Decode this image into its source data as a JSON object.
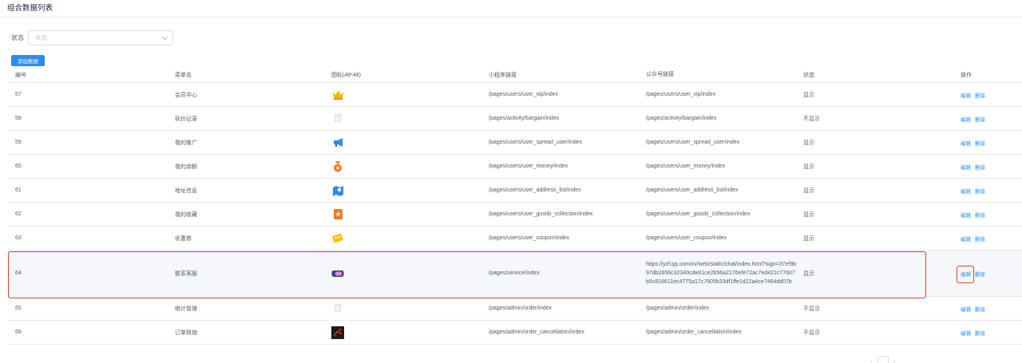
{
  "page": {
    "title": "组合数据列表"
  },
  "filter": {
    "label": "状态",
    "placeholder": "状态"
  },
  "toolbar": {
    "add_label": "添加数据"
  },
  "table": {
    "columns": [
      "编号",
      "菜单名",
      "图标(48*48)",
      "小程序链接",
      "公众号链接",
      "状态",
      "操作"
    ],
    "rows": [
      {
        "id": "57",
        "name": "会员中心",
        "icon": "crown-icon",
        "mini": "/pages/users/user_vip/index",
        "oa": "/pages/users/user_vip/index",
        "status": "显示"
      },
      {
        "id": "58",
        "name": "砍价记录",
        "icon": "placeholder-icon",
        "mini": "/pages/activity/bargain/index",
        "oa": "/pages/activity/bargain/index",
        "status": "不显示"
      },
      {
        "id": "59",
        "name": "我的推广",
        "icon": "megaphone-icon",
        "mini": "/pages/users/user_spread_user/index",
        "oa": "/pages/users/user_spread_user/index",
        "status": "显示"
      },
      {
        "id": "60",
        "name": "我的余额",
        "icon": "money-bag-icon",
        "mini": "/pages/users/user_money/index",
        "oa": "/pages/users/user_money/index",
        "status": "显示"
      },
      {
        "id": "61",
        "name": "地址信息",
        "icon": "map-icon",
        "mini": "/pages/users/user_address_list/index",
        "oa": "/pages/users/user_address_list/index",
        "status": "显示"
      },
      {
        "id": "62",
        "name": "我的收藏",
        "icon": "collection-icon",
        "mini": "/pages/users/user_goods_collection/index",
        "oa": "/pages/users/user_goods_collection/index",
        "status": "显示"
      },
      {
        "id": "63",
        "name": "优惠券",
        "icon": "coupon-icon",
        "mini": "/pages/users/user_coupon/index",
        "oa": "/pages/users/user_coupon/index",
        "status": "显示"
      },
      {
        "id": "64",
        "name": "联系客服",
        "icon": "customer-service-icon",
        "mini": "/pages/service/index",
        "oa": "https://yzf.qq.com/xv/web/static/chat/index.html?sign=37ef9b97db2656c32340cde61ce2b56a2176efe72ac7ed421c77607b5c816611ec4775a17c7605b33df1ffe1d22a4ce7464dd07b",
        "status": "显示"
      },
      {
        "id": "65",
        "name": "统计管理",
        "icon": "placeholder-icon",
        "mini": "/pages/admin/order/index",
        "oa": "/pages/admin/order/index",
        "status": "不显示"
      },
      {
        "id": "66",
        "name": "订单核销",
        "icon": "dark-image-icon",
        "mini": "/pages/admin/order_cancellation/index",
        "oa": "/pages/admin/order_cancellation/index",
        "status": "不显示"
      }
    ],
    "ops": {
      "edit": "编辑",
      "delete": "删除"
    },
    "placeholder_icon_text": [
      "加载",
      "失败"
    ]
  },
  "colors": {
    "primary": "#2d8cf0",
    "highlight": "#e2402a",
    "border": "#e8eaec"
  }
}
